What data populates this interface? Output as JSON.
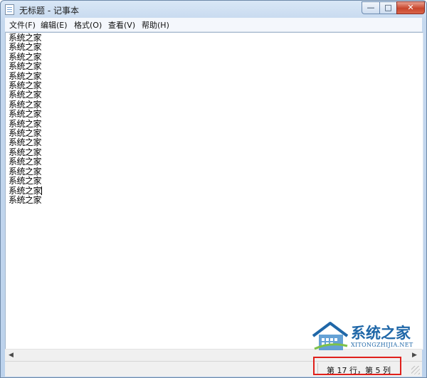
{
  "window": {
    "title": "无标题 - 记事本",
    "controls": {
      "minimize": "—",
      "maximize": "□",
      "close": "✕"
    }
  },
  "menu": {
    "items": [
      "文件(F)",
      "编辑(E)",
      "格式(O)",
      "查看(V)",
      "帮助(H)"
    ]
  },
  "editor": {
    "lines": [
      "系统之家",
      "系统之家",
      "系统之家",
      "系统之家",
      "系统之家",
      "系统之家",
      "系统之家",
      "系统之家",
      "系统之家",
      "系统之家",
      "系统之家",
      "系统之家",
      "系统之家",
      "系统之家",
      "系统之家",
      "系统之家",
      "系统之家",
      "系统之家"
    ]
  },
  "scrollbar": {
    "left_arrow": "◀",
    "right_arrow": "▶"
  },
  "status": {
    "position": "第 17 行，第 5 列"
  },
  "watermark": {
    "brand": "系统之家",
    "domain": "XITONGZHIJIA.NET"
  },
  "colors": {
    "highlight": "#e0201b",
    "watermark_blue": "#1f67a8"
  },
  "icons": {
    "app": "notepad-icon",
    "house": "house-logo-icon",
    "grip": "resize-grip-icon"
  }
}
